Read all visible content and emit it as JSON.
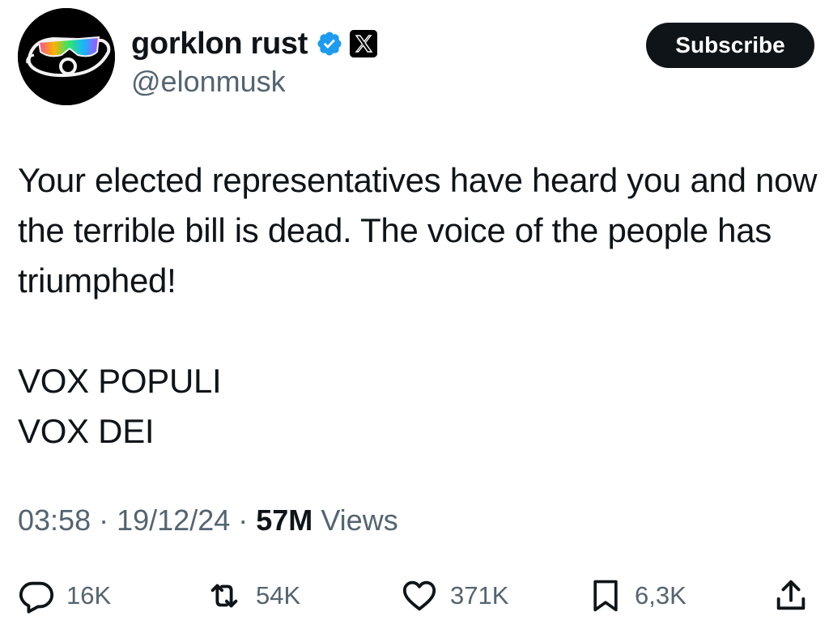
{
  "author": {
    "display_name": "gorklon rust",
    "handle": "@elonmusk",
    "verified_icon": "verified-badge-icon",
    "affiliation_icon": "x-logo-icon",
    "avatar_icon": "sunglasses-face-avatar"
  },
  "subscribe_label": "Subscribe",
  "tweet": {
    "paragraph1": "Your elected representatives have heard you and now the terrible bill is dead. The voice of the people has triumphed!",
    "line1": "VOX POPULI",
    "line2": "VOX DEI"
  },
  "meta": {
    "time": "03:58",
    "date": "19/12/24",
    "separator": "·",
    "views_count": "57M",
    "views_label": "Views"
  },
  "actions": {
    "replies": "16K",
    "reposts": "54K",
    "likes": "371K",
    "bookmarks": "6,3K"
  },
  "colors": {
    "text_primary": "#0f1419",
    "text_secondary": "#536471",
    "verified_blue": "#1d9bf0",
    "button_bg": "#0f1419"
  }
}
